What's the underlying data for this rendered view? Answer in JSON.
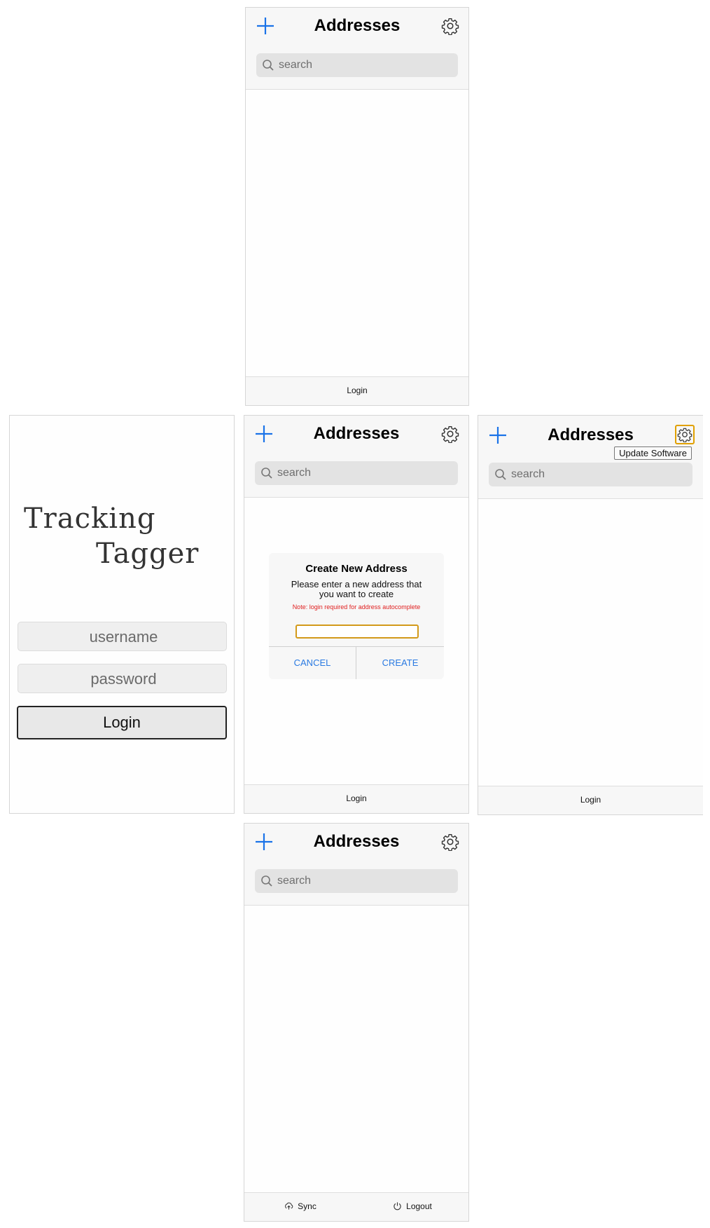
{
  "screen_top": {
    "title": "Addresses",
    "search": {
      "placeholder": "search"
    },
    "footer": {
      "login": "Login"
    }
  },
  "screen_login": {
    "logo": {
      "line1": "Tracking",
      "line2": "Tagger"
    },
    "username_placeholder": "username",
    "password_placeholder": "password",
    "login_button": "Login"
  },
  "screen_dialog": {
    "title": "Addresses",
    "search": {
      "placeholder": "search"
    },
    "dialog": {
      "title": "Create New Address",
      "message": "Please enter a new address that you want to create",
      "note": "Note: login required for address autocomplete",
      "cancel": "CANCEL",
      "create": "CREATE"
    },
    "footer": {
      "login": "Login"
    }
  },
  "screen_tooltip": {
    "title": "Addresses",
    "tooltip": "Update Software",
    "search": {
      "placeholder": "search"
    },
    "footer": {
      "login": "Login"
    }
  },
  "screen_bottom": {
    "title": "Addresses",
    "search": {
      "placeholder": "search"
    },
    "footer": {
      "sync": "Sync",
      "logout": "Logout"
    }
  },
  "colors": {
    "accent": "#1a73e8",
    "focus": "#e0a000",
    "note": "#e02020"
  },
  "icons": [
    "plus-icon",
    "gear-icon",
    "search-icon",
    "sync-icon",
    "power-icon"
  ]
}
